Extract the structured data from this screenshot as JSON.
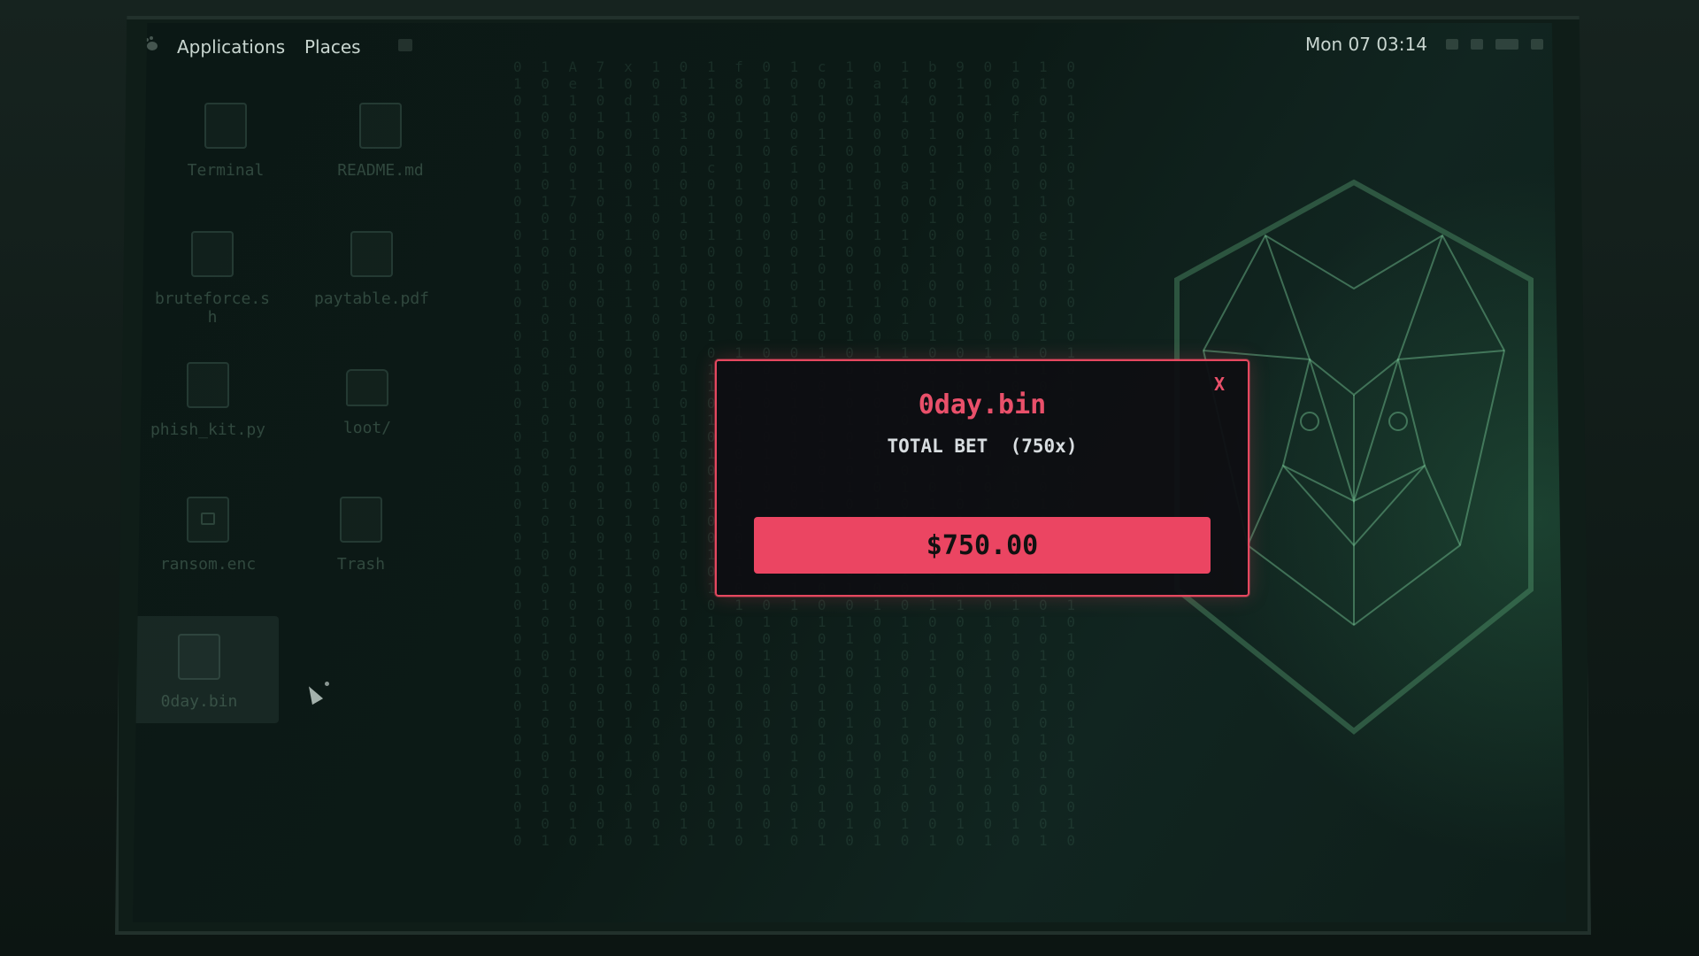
{
  "topbar": {
    "applications": "Applications",
    "places": "Places",
    "clock": "Mon 07 03:14",
    "menu_icon": "gnome-foot-icon"
  },
  "desktop": {
    "icons": [
      {
        "label": "Terminal",
        "icon": "terminal-icon"
      },
      {
        "label": "README.md",
        "icon": "file-icon"
      },
      {
        "label": "bruteforce.sh",
        "icon": "script-icon"
      },
      {
        "label": "paytable.pdf",
        "icon": "pdf-icon"
      },
      {
        "label": "phish_kit.py",
        "icon": "python-file-icon"
      },
      {
        "label": "loot/",
        "icon": "folder-icon"
      },
      {
        "label": "ransom.enc",
        "icon": "lock-file-icon"
      },
      {
        "label": "Trash",
        "icon": "trash-icon"
      },
      {
        "label": "0day.bin",
        "icon": "binary-file-icon"
      }
    ]
  },
  "dialog": {
    "title": "0day.bin",
    "subtitle": "TOTAL BET  (750x)",
    "close_label": "X",
    "amount": "$750.00"
  },
  "colors": {
    "accent": "#eb4562",
    "title": "#e9506a",
    "background": "#0b1815"
  }
}
